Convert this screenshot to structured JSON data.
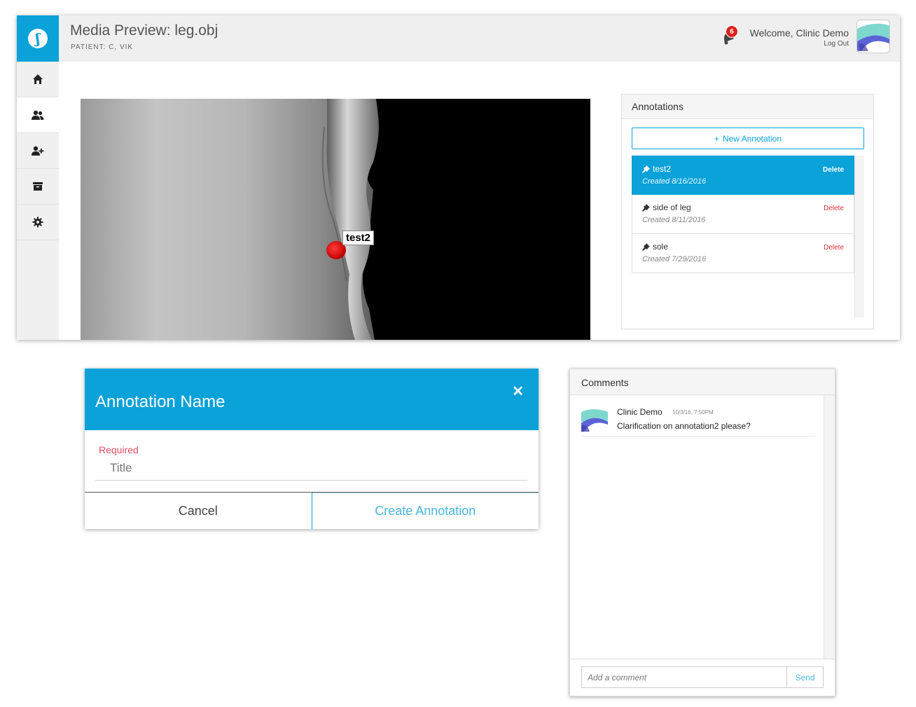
{
  "header": {
    "title": "Media Preview: leg.obj",
    "patient": "PATIENT: C, VIK",
    "notification_count": "6",
    "welcome": "Welcome, Clinic Demo",
    "logout": "Log Out",
    "logo_glyph": "ʃ"
  },
  "sidebar": {
    "items": [
      {
        "icon": "home-icon",
        "glyph": "⌂"
      },
      {
        "icon": "patients-icon",
        "glyph": "👥"
      },
      {
        "icon": "add-patient-icon",
        "glyph": "+"
      },
      {
        "icon": "archive-icon",
        "glyph": "▤"
      },
      {
        "icon": "gear-icon",
        "glyph": "⚙"
      }
    ],
    "active_index": 1
  },
  "viewer": {
    "marker_label": "test2"
  },
  "annotations": {
    "title": "Annotations",
    "new_button": "New Annotation",
    "items": [
      {
        "name": "test2",
        "created": "Created 8/16/2016",
        "delete": "Delete"
      },
      {
        "name": "side of leg",
        "created": "Created 8/11/2016",
        "delete": "Delete"
      },
      {
        "name": "sole",
        "created": "Created 7/29/2016",
        "delete": "Delete"
      }
    ],
    "selected_index": 0
  },
  "modal": {
    "title": "Annotation Name",
    "required_label": "Required",
    "title_placeholder": "Title",
    "cancel": "Cancel",
    "create": "Create Annotation"
  },
  "comments": {
    "title": "Comments",
    "items": [
      {
        "author": "Clinic Demo",
        "time": "10/3/16, 7:50PM",
        "text": "Clarification on annotation2 please?"
      }
    ],
    "input_placeholder": "Add a comment",
    "send": "Send"
  },
  "colors": {
    "accent": "#0aa2d8",
    "delete": "#e0303a",
    "badge": "#e02020",
    "required": "#e05060"
  }
}
